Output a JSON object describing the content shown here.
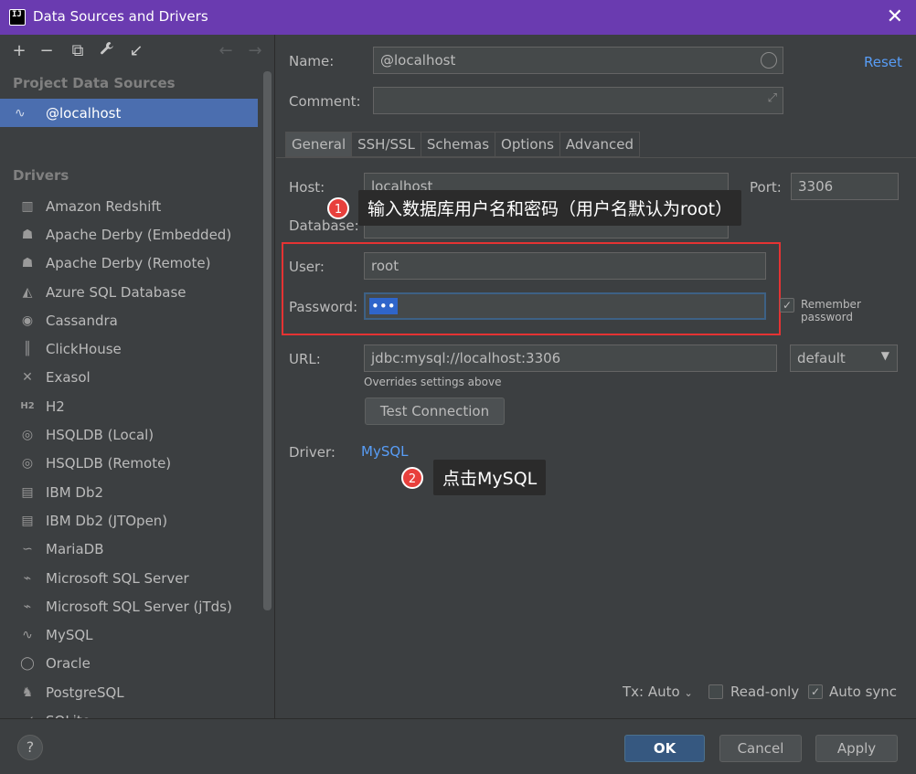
{
  "window": {
    "title": "Data Sources and Drivers",
    "close_glyph": "✕",
    "app_icon_text": "IJ"
  },
  "toolbar": {
    "add": "+",
    "remove": "−",
    "duplicate": "⧉",
    "wrench": "🔧",
    "import": "↙",
    "back": "←",
    "forward": "→"
  },
  "left": {
    "project_header": "Project Data Sources",
    "selected_source": "@localhost",
    "drivers_header": "Drivers",
    "drivers": [
      {
        "label": "Amazon Redshift",
        "icon": "redshift-icon",
        "glyph": "▥"
      },
      {
        "label": "Apache Derby (Embedded)",
        "icon": "derby-hat-icon",
        "glyph": "☗"
      },
      {
        "label": "Apache Derby (Remote)",
        "icon": "derby-hat-icon",
        "glyph": "☗"
      },
      {
        "label": "Azure SQL Database",
        "icon": "azure-icon",
        "glyph": "◭"
      },
      {
        "label": "Cassandra",
        "icon": "cassandra-eye-icon",
        "glyph": "◉"
      },
      {
        "label": "ClickHouse",
        "icon": "clickhouse-icon",
        "glyph": "║"
      },
      {
        "label": "Exasol",
        "icon": "exasol-x-icon",
        "glyph": "✕"
      },
      {
        "label": "H2",
        "icon": "h2-icon",
        "glyph": "H2"
      },
      {
        "label": "HSQLDB (Local)",
        "icon": "hsqldb-icon",
        "glyph": "◎"
      },
      {
        "label": "HSQLDB (Remote)",
        "icon": "hsqldb-icon",
        "glyph": "◎"
      },
      {
        "label": "IBM Db2",
        "icon": "ibm-db2-icon",
        "glyph": "▤"
      },
      {
        "label": "IBM Db2 (JTOpen)",
        "icon": "ibm-db2-icon",
        "glyph": "▤"
      },
      {
        "label": "MariaDB",
        "icon": "mariadb-seal-icon",
        "glyph": "∽"
      },
      {
        "label": "Microsoft SQL Server",
        "icon": "sqlserver-icon",
        "glyph": "⌁"
      },
      {
        "label": "Microsoft SQL Server (jTds)",
        "icon": "sqlserver-icon",
        "glyph": "⌁"
      },
      {
        "label": "MySQL",
        "icon": "mysql-dolphin-icon",
        "glyph": "∿"
      },
      {
        "label": "Oracle",
        "icon": "oracle-ring-icon",
        "glyph": "◯"
      },
      {
        "label": "PostgreSQL",
        "icon": "postgres-elephant-icon",
        "glyph": "♞"
      },
      {
        "label": "SQLite",
        "icon": "sqlite-icon",
        "glyph": "◢"
      }
    ]
  },
  "form": {
    "name_label": "Name:",
    "name_value": "@localhost",
    "reset_label": "Reset",
    "comment_label": "Comment:",
    "comment_value": "",
    "tabs": [
      "General",
      "SSH/SSL",
      "Schemas",
      "Options",
      "Advanced"
    ],
    "host_label": "Host:",
    "host_value": "localhost",
    "port_label": "Port:",
    "port_value": "3306",
    "database_label": "Database:",
    "database_value": "",
    "user_label": "User:",
    "user_value": "root",
    "password_label": "Password:",
    "password_value": "•••",
    "remember_password": "Remember password",
    "url_label": "URL:",
    "url_value": "jdbc:mysql://localhost:3306",
    "url_mode": "default",
    "url_hint": "Overrides settings above",
    "test_connection": "Test Connection",
    "driver_label": "Driver:",
    "driver_value": "MySQL",
    "tx_label": "Tx: Auto",
    "readonly_label": "Read-only",
    "autosync_label": "Auto sync"
  },
  "annotations": {
    "badge1": "1",
    "callout1": "输入数据库用户名和密码（用户名默认为root）",
    "badge2": "2",
    "callout2": "点击MySQL"
  },
  "footer": {
    "help": "?",
    "ok": "OK",
    "cancel": "Cancel",
    "apply": "Apply"
  },
  "colors": {
    "accent": "#4b6eaf",
    "link": "#589df6",
    "titlebar": "#6a3bb0",
    "highlight_box": "#e53333"
  }
}
